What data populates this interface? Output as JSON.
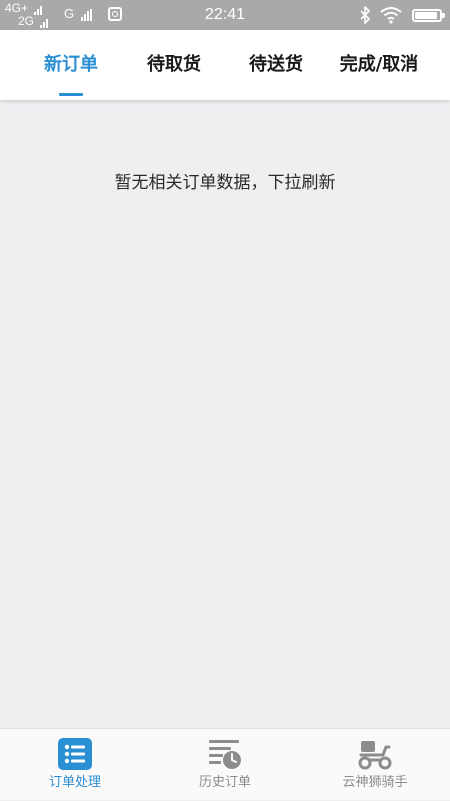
{
  "status_bar": {
    "network_line1": "4G+",
    "network_line2": "2G",
    "sim2_label": "G",
    "time": "22:41",
    "battery_level": 0.86
  },
  "tabs": [
    {
      "label": "新订单",
      "active": true
    },
    {
      "label": "待取货",
      "active": false
    },
    {
      "label": "待送货",
      "active": false
    },
    {
      "label": "完成/取消",
      "active": false
    }
  ],
  "main": {
    "empty_message": "暂无相关订单数据，下拉刷新"
  },
  "bottom_nav": {
    "items": [
      {
        "label": "订单处理",
        "icon": "order-list-icon",
        "active": true
      },
      {
        "label": "历史订单",
        "icon": "history-clock-icon",
        "active": false
      },
      {
        "label": "云神狮骑手",
        "icon": "scooter-icon",
        "active": false
      }
    ]
  },
  "colors": {
    "accent": "#2b8fd3",
    "background": "#efeef1",
    "status_bar": "#a9a9ab",
    "inactive_icon": "#8c8c8c"
  }
}
